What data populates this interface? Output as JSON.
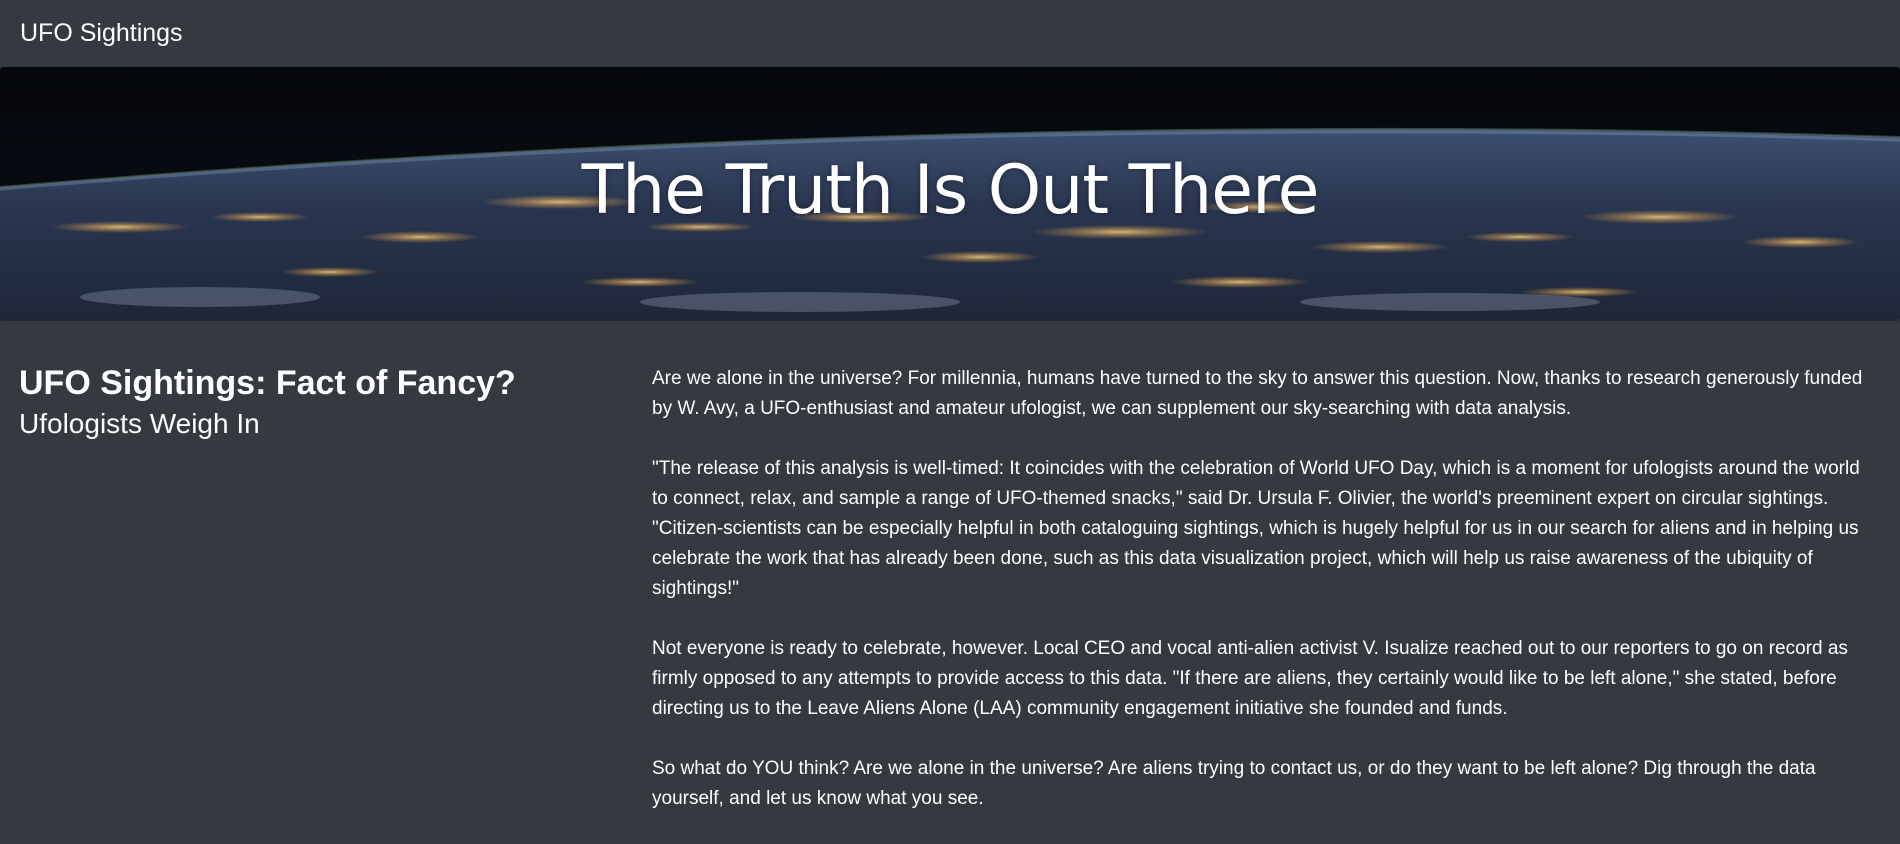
{
  "navbar": {
    "brand": "UFO Sightings"
  },
  "hero": {
    "title": "The Truth Is Out There"
  },
  "article": {
    "title": "UFO Sightings: Fact of Fancy?",
    "subtitle": "Ufologists Weigh In",
    "paragraphs": [
      "Are we alone in the universe? For millennia, humans have turned to the sky to answer this question. Now, thanks to research generously funded by W. Avy, a UFO-enthusiast and amateur ufologist, we can supplement our sky-searching with data analysis.",
      "\"The release of this analysis is well-timed: It coincides with the celebration of World UFO Day, which is a moment for ufologists around the world to connect, relax, and sample a range of UFO-themed snacks,\" said Dr. Ursula F. Olivier, the world's preeminent expert on circular sightings. \"Citizen-scientists can be especially helpful in both cataloguing sightings, which is hugely helpful for us in our search for aliens and in helping us celebrate the work that has already been done, such as this data visualization project, which will help us raise awareness of the ubiquity of sightings!\"",
      "Not everyone is ready to celebrate, however. Local CEO and vocal anti-alien activist V. Isualize reached out to our reporters to go on record as firmly opposed to any attempts to provide access to this data. \"If there are aliens, they certainly would like to be left alone,\" she stated, before directing us to the Leave Aliens Alone (LAA) community engagement initiative she founded and funds.",
      "So what do YOU think? Are we alone in the universe? Are aliens trying to contact us, or do they want to be left alone? Dig through the data yourself, and let us know what you see."
    ]
  },
  "colors": {
    "background": "#343a40",
    "text": "#ffffff"
  }
}
